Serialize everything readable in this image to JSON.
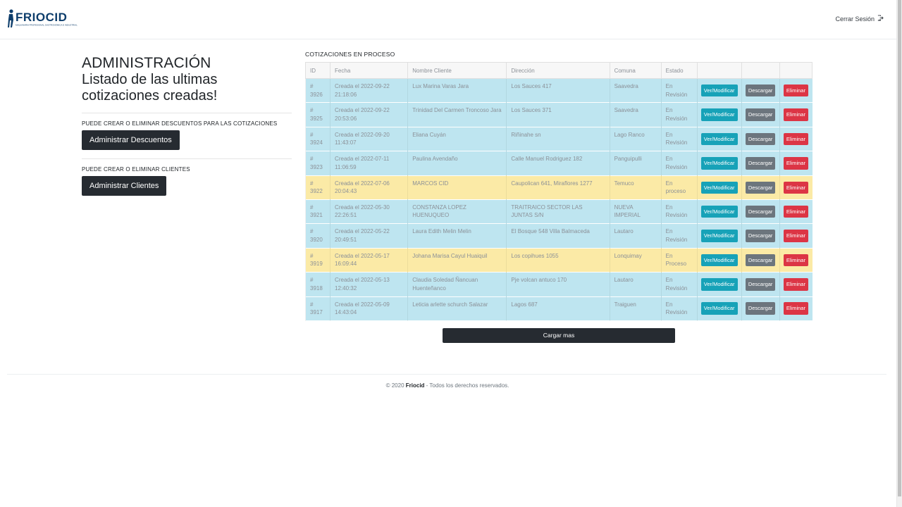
{
  "header": {
    "brand": "FRIOCID",
    "brand_tagline": "MAQUINARIA PROFESIONAL GASTRONÓMICA E INDUSTRIAL",
    "logout_label": "Cerrar Sesión"
  },
  "left": {
    "title": "ADMINISTRACIÓN",
    "subtitle": "Listado de las ultimas cotizaciones creadas!",
    "descuentos_label": "PUEDE CREAR O ELIMINAR DESCUENTOS PARA LAS COTIZACIONES",
    "descuentos_button": "Administrar Descuentos",
    "clientes_label": "PUEDE CREAR O ELIMINAR CLIENTES",
    "clientes_button": "Administrar Clientes"
  },
  "table": {
    "title": "COTIZACIONES EN PROCESO",
    "columns": [
      "ID",
      "Fecha",
      "Nombre Cliente",
      "Dirección",
      "Comuna",
      "Estado"
    ],
    "actions": {
      "view": "Ver/Modificar",
      "download": "Descargar",
      "delete": "Eliminar"
    },
    "rows": [
      {
        "id_hash": "#",
        "id": "3926",
        "date": "Creada el 2022-09-22",
        "time": "21:18:06",
        "client": "Lux Marina Varas Jara",
        "address": "Los Sauces 417",
        "comuna": "Saavedra",
        "estado": "En Revisión",
        "state": "rev"
      },
      {
        "id_hash": "#",
        "id": "3925",
        "date": "Creada el 2022-09-22",
        "time": "20:53:06",
        "client": "Trinidad Del Carmen Troncoso Jara",
        "address": "Los Sauces 371",
        "comuna": "Saavedra",
        "estado": "En Revisión",
        "state": "rev"
      },
      {
        "id_hash": "#",
        "id": "3924",
        "date": "Creada el 2022-09-20",
        "time": "11:43:07",
        "client": "Eliana Cuyán",
        "address": "Riñinahe sn",
        "comuna": "Lago Ranco",
        "estado": "En Revisión",
        "state": "rev"
      },
      {
        "id_hash": "#",
        "id": "3923",
        "date": "Creada el 2022-07-11",
        "time": "11:06:59",
        "client": "Paulina Avendaño",
        "address": "Calle Manuel Rodriguez 182",
        "comuna": "Panguipulli",
        "estado": "En Revisión",
        "state": "rev"
      },
      {
        "id_hash": "#",
        "id": "3922",
        "date": "Creada el 2022-07-06",
        "time": "20:04:43",
        "client": "MARCOS CID",
        "address": "Caupolican 641, Miraflores 1277",
        "comuna": "Temuco",
        "estado": "En proceso",
        "state": "proc"
      },
      {
        "id_hash": "#",
        "id": "3921",
        "date": "Creada el 2022-05-30",
        "time": "22:26:51",
        "client": "CONSTANZA LOPEZ HUENUQUEO",
        "address": "TRAITRAICO SECTOR LAS JUNTAS S/N",
        "comuna": "NUEVA IMPERIAL",
        "estado": "En Revisión",
        "state": "rev"
      },
      {
        "id_hash": "#",
        "id": "3920",
        "date": "Creada el 2022-05-22",
        "time": "20:49:51",
        "client": "Laura Edith Melin Melin",
        "address": "El Bosque 548 Villa Balmaceda",
        "comuna": "Lautaro",
        "estado": "En Revisión",
        "state": "rev"
      },
      {
        "id_hash": "#",
        "id": "3919",
        "date": "Creada el 2022-05-17",
        "time": "16:09:44",
        "client": "Johana Marisa Cayul Huaiquil",
        "address": "Los copihues 1055",
        "comuna": "Lonquimay",
        "estado": "En Proceso",
        "state": "proc"
      },
      {
        "id_hash": "#",
        "id": "3918",
        "date": "Creada el 2022-05-13",
        "time": "12:40:32",
        "client": "Claudia Soledad Ñancuan Huenteñanco",
        "address": "Pje volcan antuco 170",
        "comuna": "Lautaro",
        "estado": "En Revisión",
        "state": "rev"
      },
      {
        "id_hash": "#",
        "id": "3917",
        "date": "Creada el 2022-05-09",
        "time": "14:43:04",
        "client": "Leticia arlette schurch Salazar",
        "address": "Lagos 687",
        "comuna": "Traiguen",
        "estado": "En Revisión",
        "state": "rev"
      }
    ],
    "load_more": "Cargar mas"
  },
  "footer": {
    "copyright": "© 2020",
    "brand": "Friocid",
    "rights": "- Todos los derechos reservados."
  }
}
